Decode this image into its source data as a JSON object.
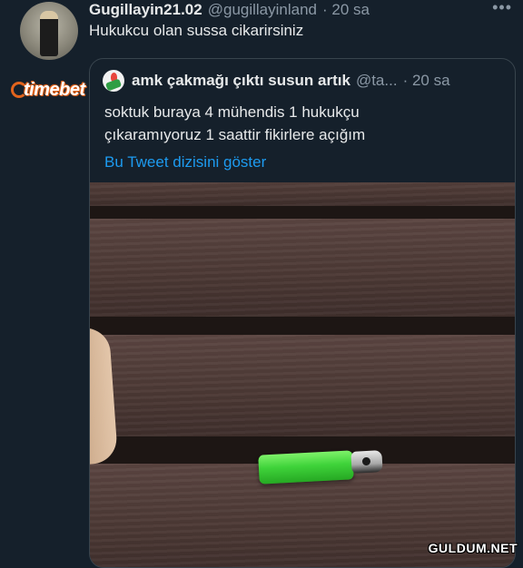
{
  "tweet": {
    "display_name": "Gugillayin21.02",
    "handle": "@gugillayinland",
    "time": "· 20 sa",
    "more_icon": "more-horizontal-icon",
    "text": "Hukukcu olan sussa cikarirsiniz"
  },
  "overlay_brand": {
    "logo_text": "timebet"
  },
  "quote": {
    "display_name": "amk çakmağı çıktı susun artık",
    "handle": "@ta...",
    "time": "· 20 sa",
    "text_lines": [
      "soktuk buraya 4 mühendis 1 hukukçu",
      "çıkaramıyoruz 1 saattir fikirlere açığım"
    ],
    "thread_link": "Bu Tweet dizisini göster"
  },
  "photo": {
    "description_icon": "lighter-between-planks-photo"
  },
  "watermark": {
    "text": "GULDUM.NET"
  },
  "colors": {
    "background": "#15202b",
    "link": "#1d9bf0",
    "secondary_text": "#8b98a5",
    "primary_text": "#e7e9ea",
    "brand_orange": "#e2641d"
  }
}
